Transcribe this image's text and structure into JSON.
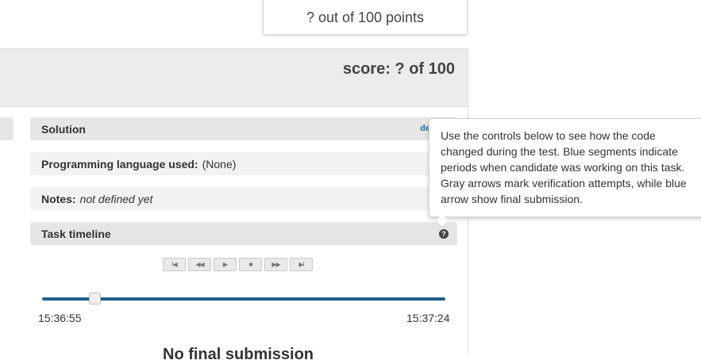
{
  "points_box": {
    "text": "? out of 100 points"
  },
  "score_header": {
    "title": "score: ? of 100"
  },
  "rows": {
    "solution": {
      "label": "Solution",
      "link": "de"
    },
    "language": {
      "label": "Programming language used:",
      "value": "(None)"
    },
    "notes": {
      "label": "Notes:",
      "value": "not defined yet"
    },
    "timeline": {
      "label": "Task timeline",
      "help": "?"
    }
  },
  "controls": [
    {
      "name": "skip-to-start",
      "glyph": "I◀"
    },
    {
      "name": "rewind",
      "glyph": "◀◀"
    },
    {
      "name": "play",
      "glyph": "▶"
    },
    {
      "name": "stop",
      "glyph": "■"
    },
    {
      "name": "fast-forward",
      "glyph": "▶▶"
    },
    {
      "name": "skip-to-end",
      "glyph": "▶I"
    }
  ],
  "timeline": {
    "start_time": "15:36:55",
    "end_time": "15:37:24",
    "position_fraction": 0.13
  },
  "cut_text": "No final submission",
  "tooltip": {
    "text": "Use the controls below to see how the code changed during the test. Blue segments indicate periods when candidate was working on this task. Gray arrows mark verification attempts, while blue arrow show final submission."
  },
  "colors": {
    "accent": "#1f5f8b",
    "header_bg": "#ececec",
    "row_dark": "#e6e6e6",
    "row_light": "#f2f2f2"
  }
}
